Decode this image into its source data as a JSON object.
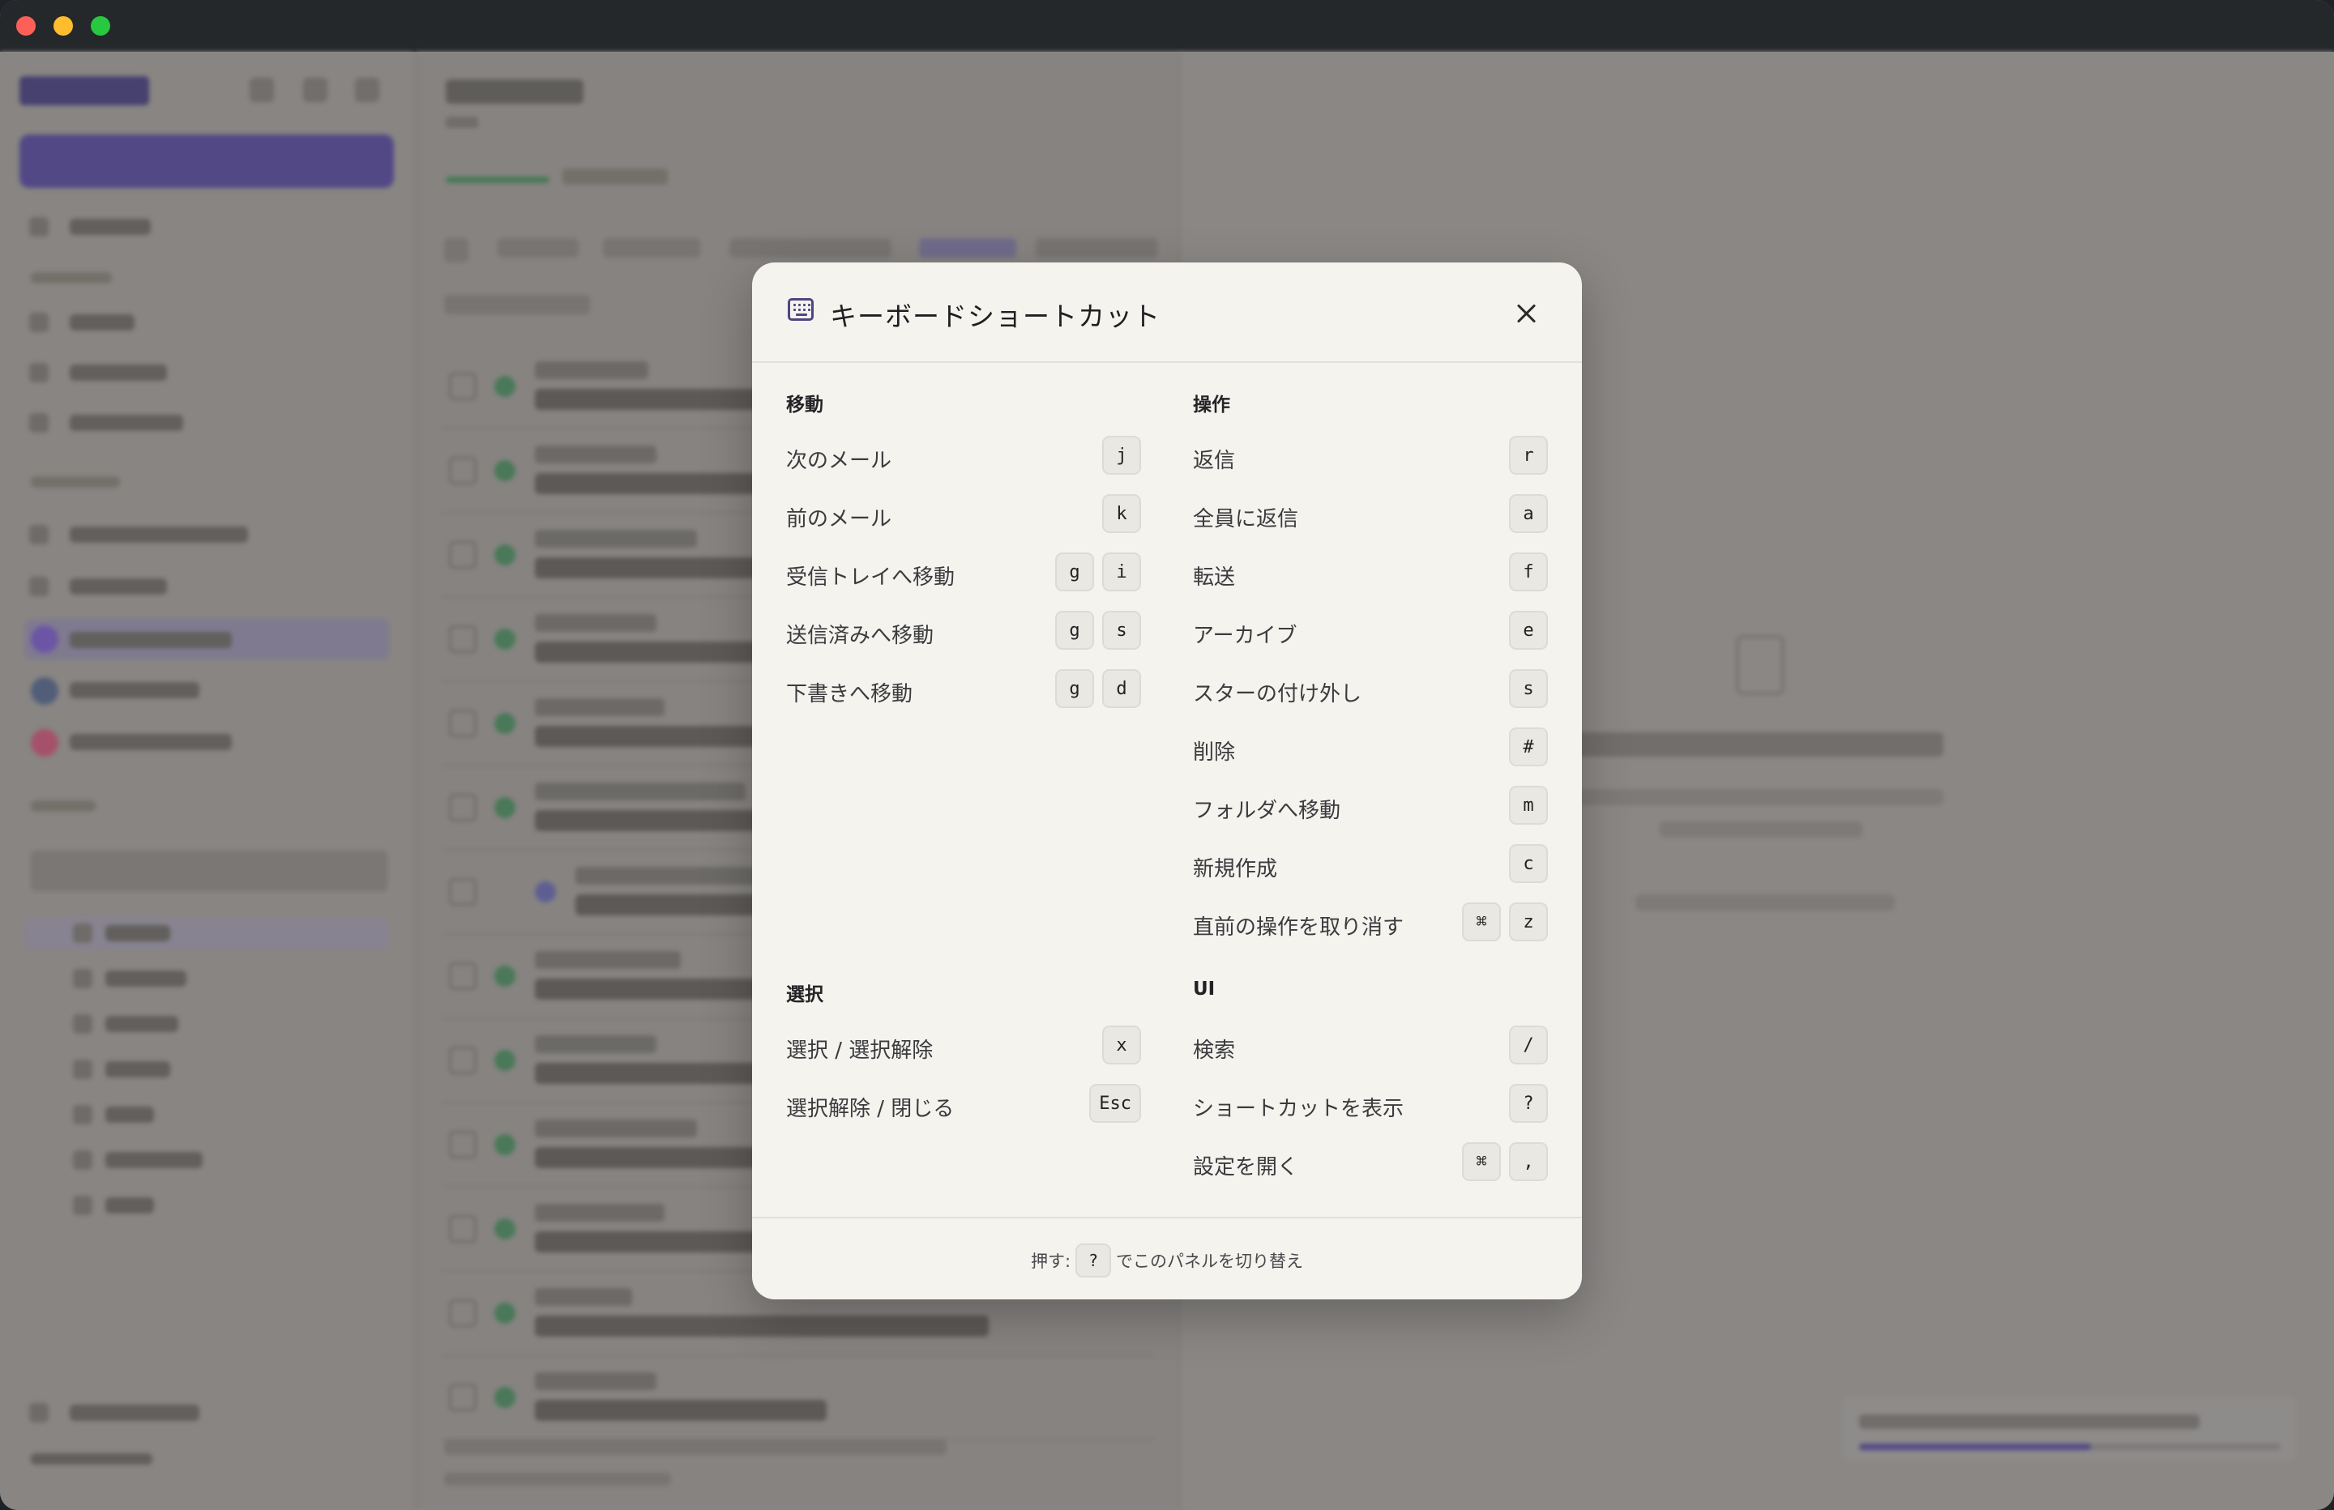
{
  "modal": {
    "title": "キーボードショートカット",
    "icon": "keyboard-icon",
    "close_icon": "close-icon",
    "sections": {
      "move": {
        "title": "移動",
        "items": [
          {
            "label": "次のメール",
            "keys": [
              "j"
            ]
          },
          {
            "label": "前のメール",
            "keys": [
              "k"
            ]
          },
          {
            "label": "受信トレイへ移動",
            "keys": [
              "g",
              "i"
            ]
          },
          {
            "label": "送信済みへ移動",
            "keys": [
              "g",
              "s"
            ]
          },
          {
            "label": "下書きへ移動",
            "keys": [
              "g",
              "d"
            ]
          }
        ]
      },
      "actions": {
        "title": "操作",
        "items": [
          {
            "label": "返信",
            "keys": [
              "r"
            ]
          },
          {
            "label": "全員に返信",
            "keys": [
              "a"
            ]
          },
          {
            "label": "転送",
            "keys": [
              "f"
            ]
          },
          {
            "label": "アーカイブ",
            "keys": [
              "e"
            ]
          },
          {
            "label": "スターの付け外し",
            "keys": [
              "s"
            ]
          },
          {
            "label": "削除",
            "keys": [
              "#"
            ]
          },
          {
            "label": "フォルダへ移動",
            "keys": [
              "m"
            ]
          },
          {
            "label": "新規作成",
            "keys": [
              "c"
            ]
          },
          {
            "label": "直前の操作を取り消す",
            "keys": [
              "⌘",
              "z"
            ]
          }
        ]
      },
      "select": {
        "title": "選択",
        "items": [
          {
            "label": "選択 / 選択解除",
            "keys": [
              "x"
            ]
          },
          {
            "label": "選択解除 / 閉じる",
            "keys": [
              "Esc"
            ]
          }
        ]
      },
      "ui": {
        "title": "UI",
        "items": [
          {
            "label": "検索",
            "keys": [
              "/"
            ]
          },
          {
            "label": "ショートカットを表示",
            "keys": [
              "?"
            ]
          },
          {
            "label": "設定を開く",
            "keys": [
              "⌘",
              ","
            ]
          }
        ]
      }
    },
    "footer": {
      "prefix": "押す:",
      "key": "?",
      "suffix": "でこのパネルを切り替え"
    }
  },
  "colors": {
    "accent": "#4e4682",
    "modal_bg": "#f4f3ee",
    "key_bg": "#e9e8e3"
  }
}
